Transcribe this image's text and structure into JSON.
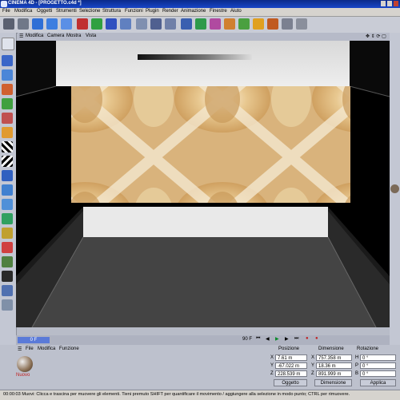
{
  "title": "CINEMA 4D - [PROGETTO.c4d *]",
  "menu": [
    "File",
    "Modifica",
    "Oggetti",
    "Strumenti",
    "Selezione",
    "Struttura",
    "Funzioni",
    "Plugin",
    "Render",
    "Animazione",
    "Finestre",
    "Aiuto"
  ],
  "viewport_menu": [
    "Modifica",
    "Camera",
    "Mostra",
    "Vista"
  ],
  "timeline": {
    "start_frame": "0 F",
    "end_frame": "90 F"
  },
  "material_menu": [
    "File",
    "Modifica",
    "Funzione"
  ],
  "material_name": "Nuovo",
  "coords": {
    "headers": [
      "Posizione",
      "Dimensione",
      "Rotazione"
    ],
    "rows": [
      {
        "axis": "X",
        "pos": "7.61 m",
        "axis2": "X",
        "dim": "757.358 m",
        "axis3": "H",
        "rot": "0 °"
      },
      {
        "axis": "Y",
        "pos": "-67.022 m",
        "axis2": "Y",
        "dim": "18.36 m",
        "axis3": "P",
        "rot": "0 °"
      },
      {
        "axis": "Z",
        "pos": "228.539 m",
        "axis2": "Z",
        "dim": "891.999 m",
        "axis3": "B",
        "rot": "0 °"
      }
    ],
    "mode1": "Oggetto",
    "mode2": "Dimensione",
    "apply": "Applica"
  },
  "status": "00:00:03  Muovi: Clicca e trascina per muovere gli elementi. Tieni premuto SHIFT per quantificare il movimento / aggiungere alla selezione in modo punto; CTRL per rimuovere.",
  "colors": {
    "accent": "#1846c8",
    "viewport_bg": "#000000",
    "marble": "#d8b27a"
  }
}
